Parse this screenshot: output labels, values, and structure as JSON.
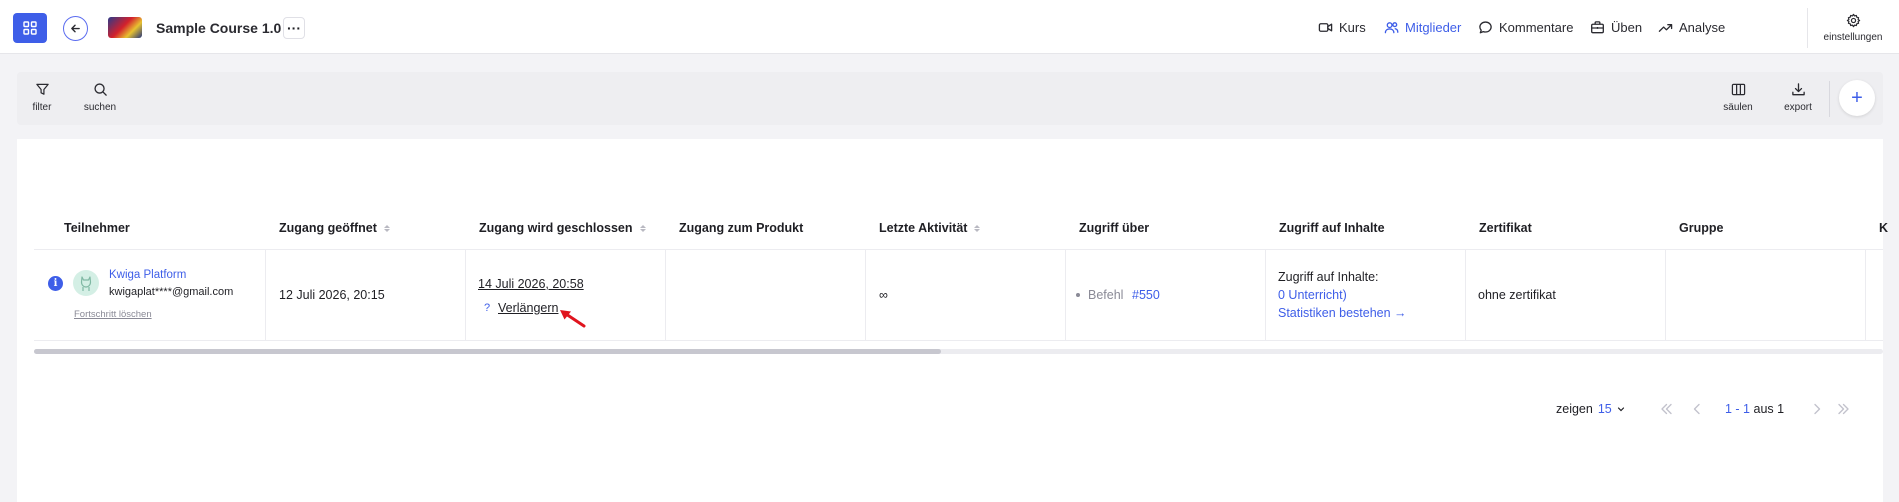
{
  "header": {
    "course_title": "Sample Course 1.0",
    "more_label": "···",
    "nav": [
      {
        "label": "Kurs",
        "icon": "video-icon"
      },
      {
        "label": "Mitglieder",
        "icon": "users-icon",
        "active": true
      },
      {
        "label": "Kommentare",
        "icon": "comment-icon"
      },
      {
        "label": "Üben",
        "icon": "briefcase-icon"
      },
      {
        "label": "Analyse",
        "icon": "trend-icon"
      }
    ],
    "settings_label": "einstellungen"
  },
  "toolbar": {
    "filter_label": "filter",
    "search_label": "suchen",
    "columns_label": "säulen",
    "export_label": "export",
    "add_label": "+"
  },
  "table": {
    "columns": [
      "Teilnehmer",
      "Zugang geöffnet",
      "Zugang wird geschlossen",
      "Zugang zum Produkt",
      "Letzte Aktivität",
      "Zugriff über",
      "Zugriff auf Inhalte",
      "Zertifikat",
      "Gruppe",
      "K"
    ],
    "row": {
      "user_name": "Kwiga Platform",
      "user_email": "kwigaplat****@gmail.com",
      "reset_progress": "Fortschritt löschen",
      "access_opened": "12 Juli 2026, 20:15",
      "access_closes": "14 Juli 2026, 20:58",
      "help_mark": "?",
      "extend_label": "Verlängern",
      "last_activity": "∞",
      "access_via_label": "Befehl",
      "access_via_link": "#550",
      "content_access_title": "Zugriff auf Inhalte:",
      "content_lessons": "0 Unterricht)",
      "content_stats": "Statistiken bestehen →",
      "certificate": "ohne zertifikat"
    }
  },
  "pagination": {
    "show_label": "zeigen",
    "page_size": "15",
    "range": "1 - 1",
    "of_label": "aus 1"
  },
  "colors": {
    "accent": "#3e5ee8",
    "annotation_arrow": "#e0141e"
  }
}
